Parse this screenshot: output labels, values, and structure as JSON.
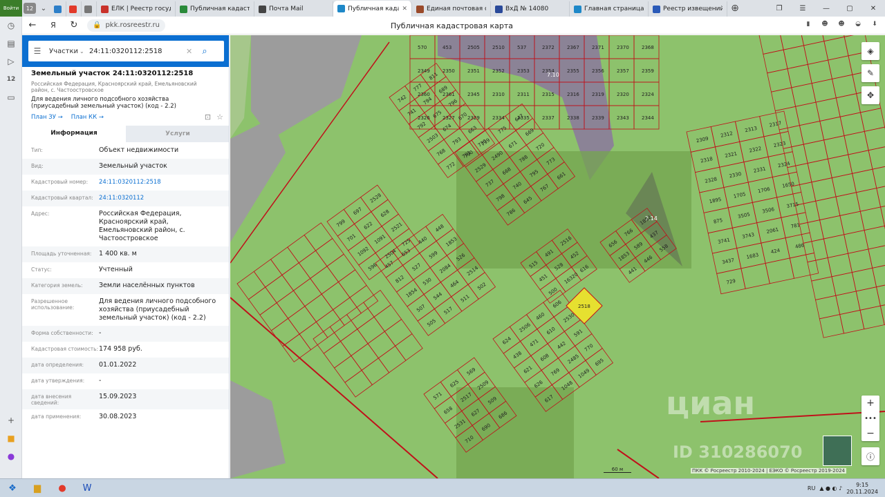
{
  "browser": {
    "tab_count": "12",
    "tabs": [
      {
        "label": "ЕЛК | Реестр государ",
        "color": "#c9322a"
      },
      {
        "label": "Публичная кадастро",
        "color": "#2a8a3a"
      },
      {
        "label": "Почта Mail",
        "color": "#444444"
      },
      {
        "label": "Публичная кадаст",
        "color": "#1e88c8",
        "active": true
      },
      {
        "label": "Единая почтовая си",
        "color": "#9a4a2a"
      },
      {
        "label": "ВхД № 14080",
        "color": "#2a4a9a"
      },
      {
        "label": "Главная страница",
        "color": "#1e88c8"
      },
      {
        "label": "Реестр извещений",
        "color": "#2a5ab8"
      }
    ],
    "url": "pkk.rosreestr.ru",
    "page_title": "Публичная кадастровая карта",
    "login_label": "Войти"
  },
  "search": {
    "type": "Участки",
    "query": "24:11:0320112:2518"
  },
  "object": {
    "title": "Земельный участок 24:11:0320112:2518",
    "address_short": "Российская Федерация, Красноярский край, Емельяновский район, с. Частоостровское",
    "use": "Для ведения личного подсобного хозяйства (приусадебный земельный участок) (код - 2.2)",
    "link_plan_zu": "План ЗУ →",
    "link_plan_kk": "План КК →"
  },
  "panel_tabs": {
    "info": "Информация",
    "services": "Услуги"
  },
  "attributes": [
    {
      "key": "Тип:",
      "value": "Объект недвижимости"
    },
    {
      "key": "Вид:",
      "value": "Земельный участок"
    },
    {
      "key": "Кадастровый номер:",
      "value": "24:11:0320112:2518",
      "link": true
    },
    {
      "key": "Кадастровый квартал:",
      "value": "24:11:0320112",
      "link": true
    },
    {
      "key": "Адрес:",
      "value": "Российская Федерация, Красноярский край, Емельяновский район, с. Частоостровское"
    },
    {
      "key": "Площадь уточненная:",
      "value": "1 400 кв. м"
    },
    {
      "key": "Статус:",
      "value": "Учтенный"
    },
    {
      "key": "Категория земель:",
      "value": "Земли населённых пунктов"
    },
    {
      "key": "Разрешенное использование:",
      "value": "Для ведения личного подсобного хозяйства (приусадебный земельный участок) (код - 2.2)"
    },
    {
      "key": "Форма собственности:",
      "value": "-"
    },
    {
      "key": "Кадастровая стоимость:",
      "value": "174 958 руб."
    },
    {
      "key": "дата определения:",
      "value": "01.01.2022"
    },
    {
      "key": "дата утверждения:",
      "value": "-"
    },
    {
      "key": "дата внесения сведений:",
      "value": "15.09.2023"
    },
    {
      "key": "дата применения:",
      "value": "30.08.2023"
    }
  ],
  "map": {
    "scale": "60 м",
    "copyright": "ПКК © Росреестр 2010-2024 | ЕЭКО © Росреестр 2019-2024",
    "watermark": "циан",
    "watermark_id": "ID 310286070",
    "selected_parcel": "2518",
    "selected_color": "#e6e030",
    "parcel_line_color": "#c0101a",
    "zone_labels": [
      "7.10",
      "7.14"
    ],
    "parcel_labels": [
      "742",
      "777",
      "811",
      "741",
      "794",
      "689",
      "792",
      "675",
      "796",
      "2503",
      "674",
      "670",
      "768",
      "793",
      "663",
      "772",
      "791",
      "730",
      "790",
      "739",
      "775",
      "647",
      "2529",
      "2490",
      "671",
      "669",
      "737",
      "668",
      "788",
      "720",
      "798",
      "740",
      "795",
      "773",
      "786",
      "645",
      "767",
      "661",
      "799",
      "697",
      "2528",
      "701",
      "622",
      "628",
      "1092",
      "1091",
      "2521",
      "596",
      "2504",
      "725",
      "457",
      "653",
      "440",
      "448",
      "812",
      "527",
      "599",
      "1853",
      "1854",
      "530",
      "2084",
      "526",
      "507",
      "544",
      "464",
      "2514",
      "505",
      "517",
      "511",
      "502",
      "515",
      "491",
      "2516",
      "451",
      "528",
      "452",
      "500",
      "16320",
      "616",
      "624",
      "2506",
      "460",
      "606",
      "438",
      "471",
      "610",
      "2530",
      "621",
      "608",
      "442",
      "591",
      "626",
      "769",
      "2485",
      "770",
      "617",
      "1048",
      "1049",
      "695",
      "571",
      "625",
      "569",
      "658",
      "2517",
      "2509",
      "2531",
      "627",
      "509",
      "710",
      "690",
      "686",
      "656",
      "766",
      "1852",
      "1853",
      "589",
      "437",
      "441",
      "446",
      "558",
      "570",
      "453",
      "2505",
      "2510",
      "537",
      "2372",
      "2367",
      "2371",
      "2370",
      "2368",
      "2349",
      "2350",
      "2351",
      "2352",
      "2353",
      "2354",
      "2355",
      "2356",
      "2357",
      "2359",
      "2360",
      "2361",
      "2345",
      "2310",
      "2311",
      "2315",
      "2316",
      "2319",
      "2320",
      "2324",
      "2326",
      "2327",
      "2329",
      "2334",
      "2335",
      "2337",
      "2338",
      "2339",
      "2343",
      "2344",
      "2309",
      "2312",
      "2313",
      "2317",
      "2318",
      "2321",
      "2322",
      "2323",
      "2328",
      "2330",
      "2331",
      "2324",
      "1895",
      "1705",
      "1706",
      "1650",
      "875",
      "3505",
      "3506",
      "3715",
      "3741",
      "3743",
      "2061",
      "781",
      "3437",
      "1683",
      "424",
      "486",
      "729"
    ]
  },
  "taskbar": {
    "lang": "RU",
    "time": "9:15",
    "date": "20.11.2024"
  }
}
